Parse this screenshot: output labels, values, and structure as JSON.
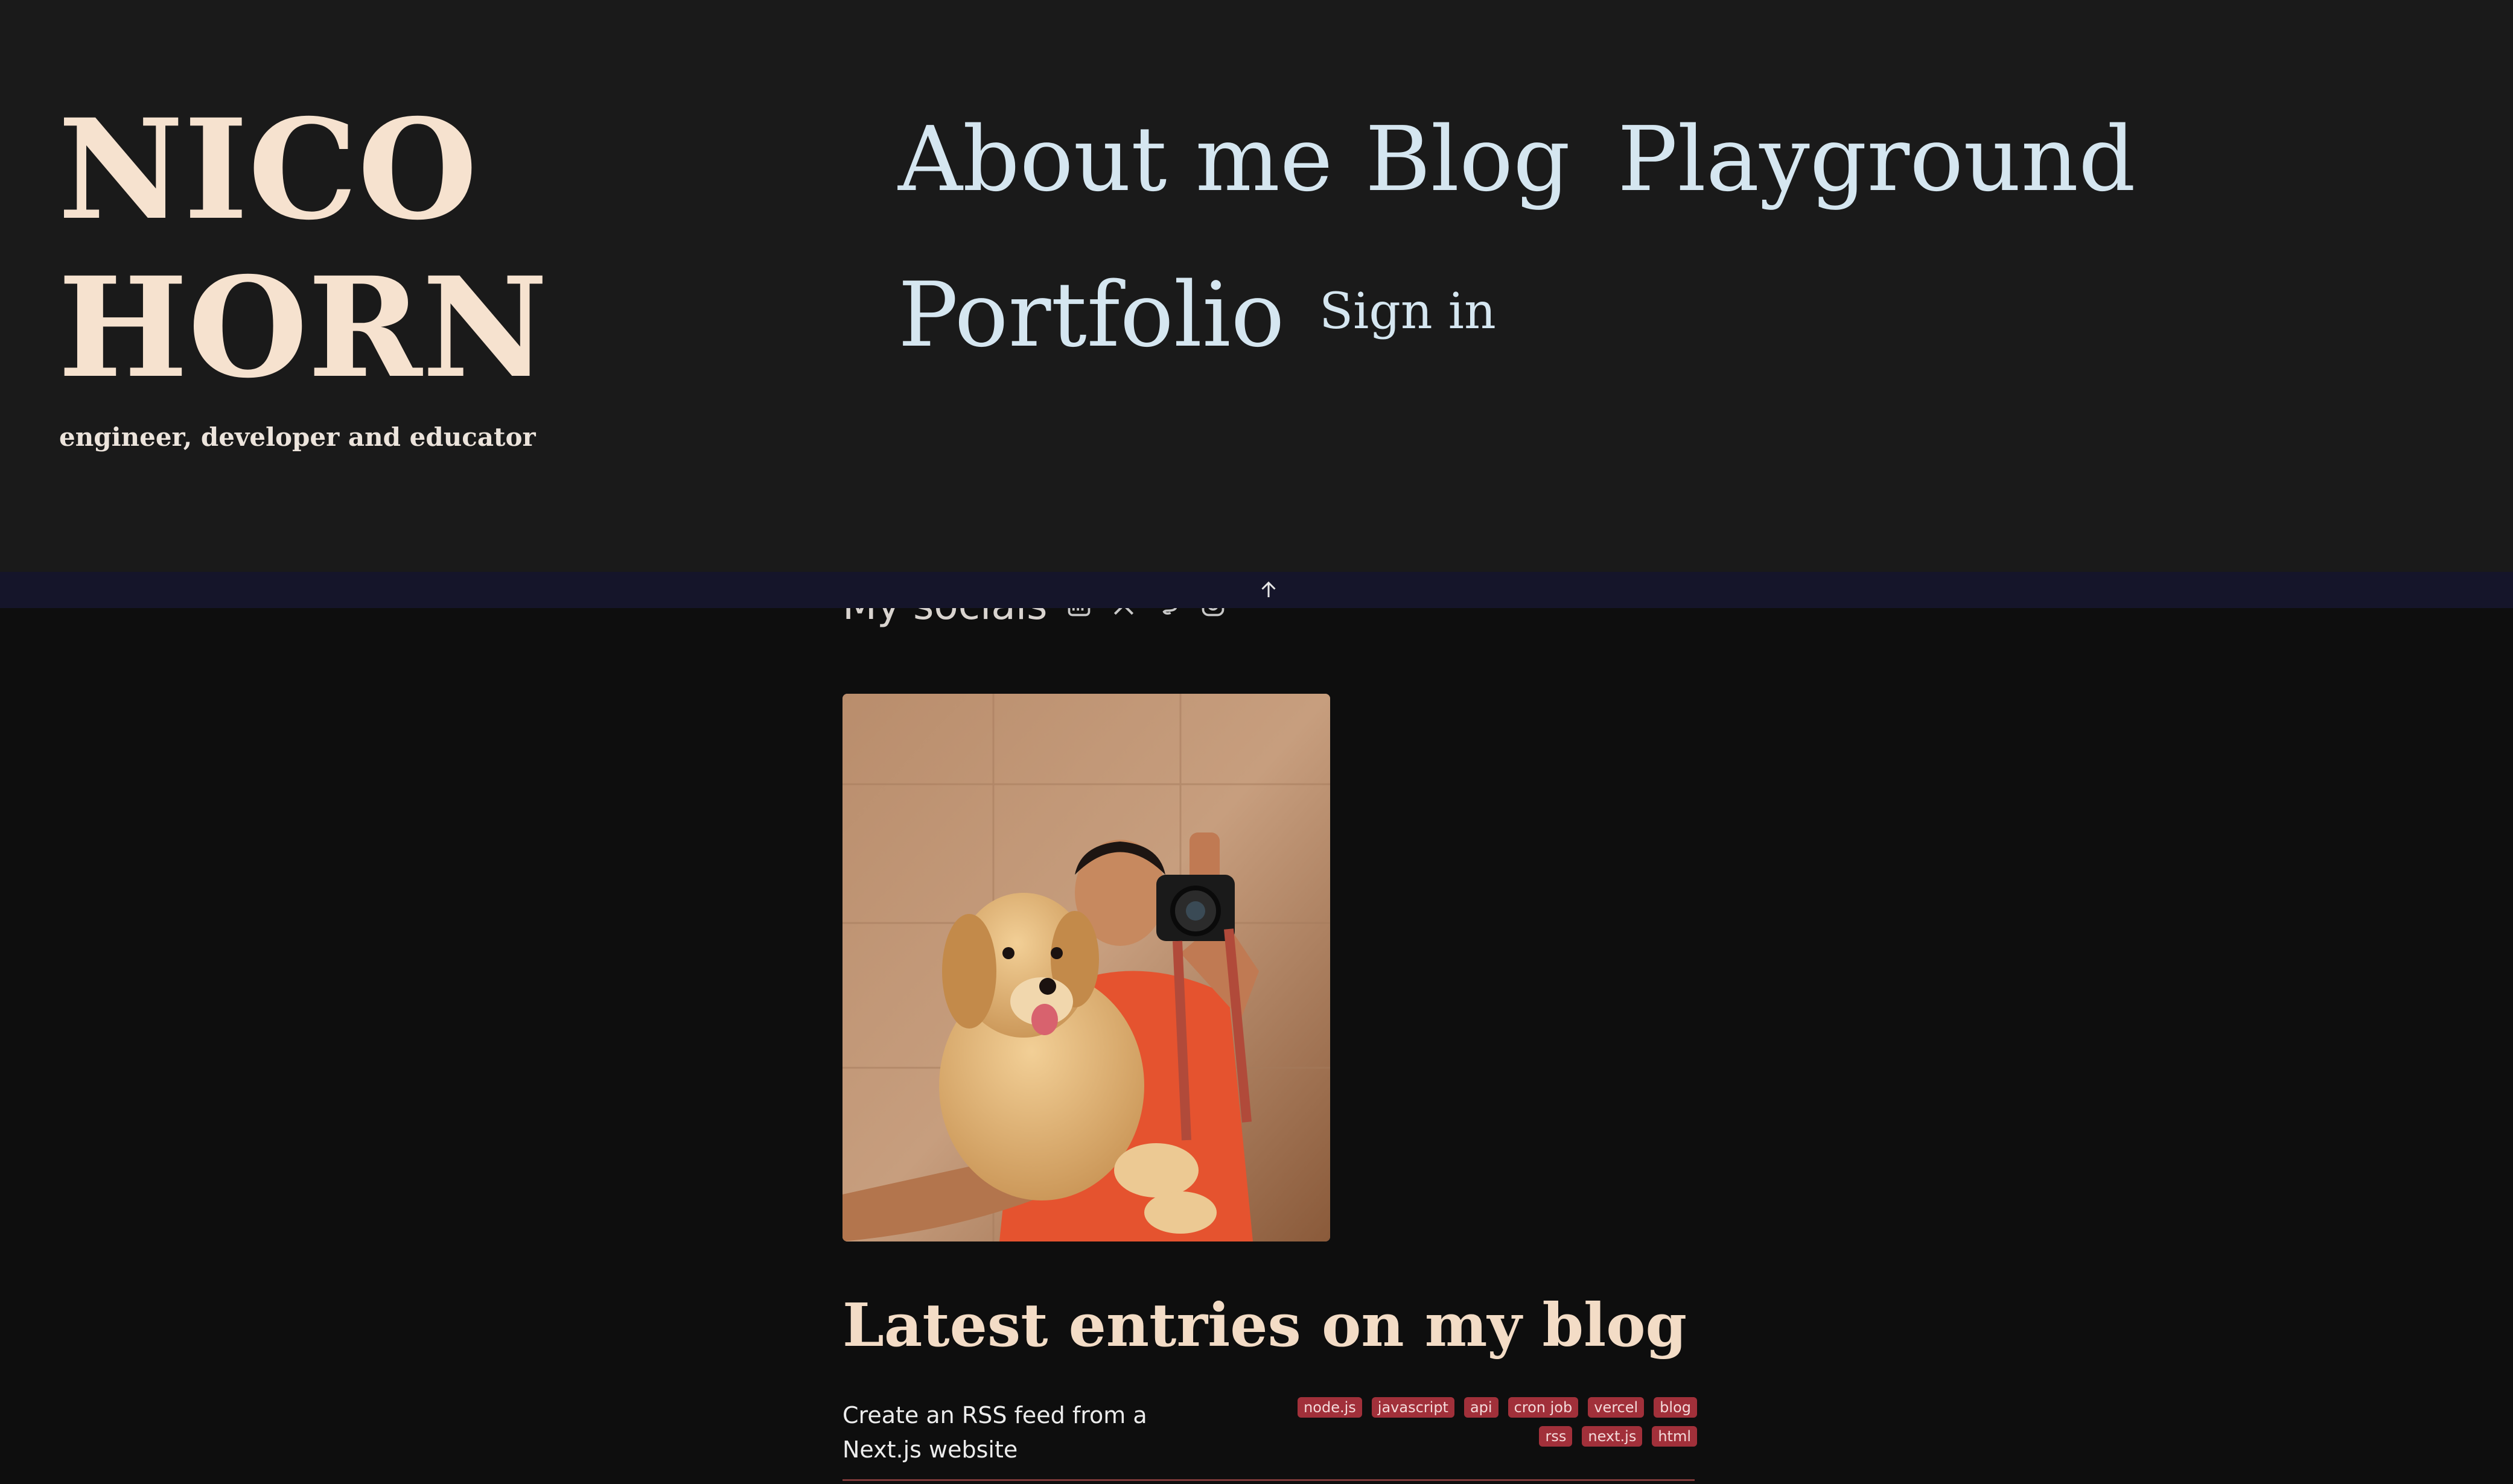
{
  "header": {
    "brand_line1": "NICO",
    "brand_line2": "HORN",
    "tagline": "engineer, developer and educator",
    "nav": {
      "about": "About me",
      "blog": "Blog",
      "playground": "Playground",
      "portfolio": "Portfolio",
      "signin": "Sign in"
    }
  },
  "scroll_top": {
    "icon": "arrow-up-icon"
  },
  "socials": {
    "title": "My socials",
    "icons": [
      "linkedin-icon",
      "x-icon",
      "mastodon-icon",
      "instagram-icon"
    ]
  },
  "photo": {
    "subject": "profile-photo"
  },
  "blog": {
    "heading": "Latest entries on my blog",
    "entries": [
      {
        "title": "Create an RSS feed from a Next.js website",
        "tags": [
          "node.js",
          "javascript",
          "api",
          "cron job",
          "vercel",
          "blog",
          "rss",
          "next.js",
          "html"
        ]
      }
    ]
  },
  "colors": {
    "header_bg": "#1a1a1a",
    "page_bg": "#0e0e0e",
    "brand": "#f6e2cf",
    "nav": "#d5e6f0",
    "tag_bg": "#a1303a",
    "topbar_bg": "#15152a"
  }
}
